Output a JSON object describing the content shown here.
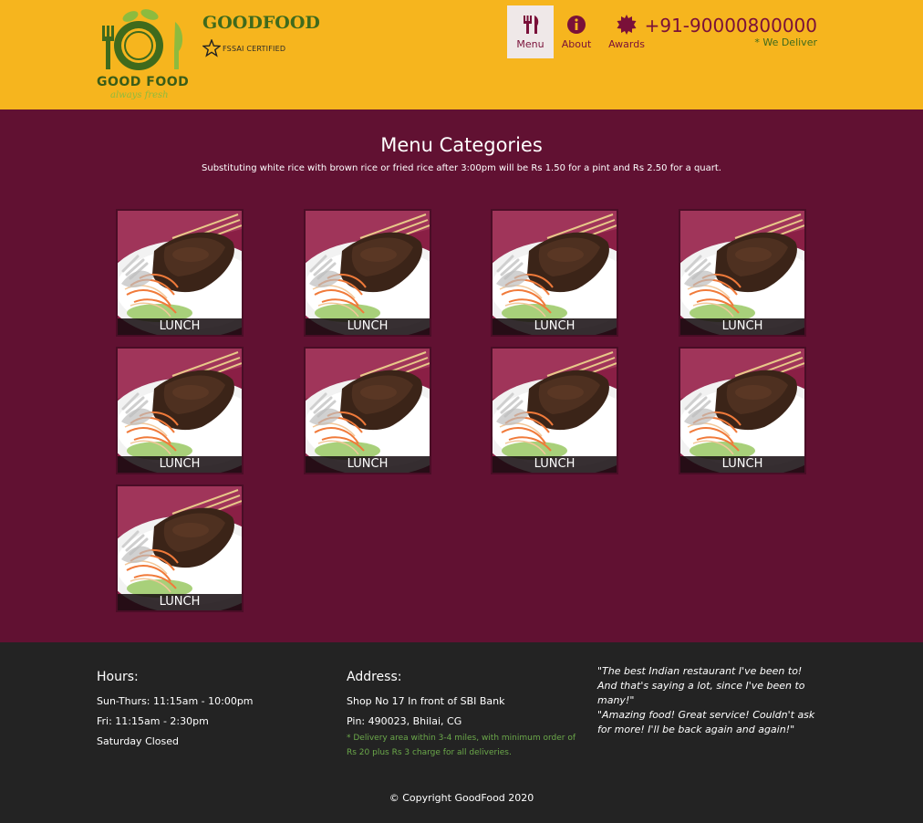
{
  "header": {
    "logo_text": "GOOD FOOD",
    "logo_tagline": "always fresh",
    "brand": "GOODFOOD",
    "certification": "FSSAI CERTIFIED",
    "phone": "+91-90000800000",
    "delivery_note": "* We Deliver"
  },
  "nav": {
    "items": [
      {
        "label": "Menu",
        "icon": "fork-knife-icon",
        "active": true
      },
      {
        "label": "About",
        "icon": "info-circle-icon",
        "active": false
      },
      {
        "label": "Awards",
        "icon": "award-badge-icon",
        "active": false
      }
    ]
  },
  "main": {
    "title": "Menu Categories",
    "subtitle": "Substituting white rice with brown rice or fried rice after 3:00pm will be Rs 1.50 for a pint and Rs 2.50 for a quart.",
    "categories": [
      {
        "label": "LUNCH"
      },
      {
        "label": "LUNCH"
      },
      {
        "label": "LUNCH"
      },
      {
        "label": "LUNCH"
      },
      {
        "label": "LUNCH"
      },
      {
        "label": "LUNCH"
      },
      {
        "label": "LUNCH"
      },
      {
        "label": "LUNCH"
      },
      {
        "label": "LUNCH"
      }
    ]
  },
  "footer": {
    "hours": {
      "heading": "Hours:",
      "lines": [
        "Sun-Thurs: 11:15am - 10:00pm",
        "Fri: 11:15am - 2:30pm",
        "Saturday Closed"
      ]
    },
    "address": {
      "heading": "Address:",
      "lines": [
        "Shop No 17 In front of SBI Bank",
        "Pin: 490023, Bhilai, CG"
      ],
      "note": "* Delivery area within 3-4 miles, with minimum order of Rs 20 plus Rs 3 charge for all deliveries."
    },
    "quotes": [
      "\"The best Indian restaurant I've been to! And that's saying a lot, since I've been to many!\"",
      "\"Amazing food! Great service! Couldn't ask for more! I'll be back again and again!\""
    ],
    "copyright": "© Copyright GoodFood 2020"
  },
  "colors": {
    "header_bg": "#f6b51e",
    "main_bg": "#611132",
    "footer_bg": "#232323",
    "accent": "#7a1039",
    "green": "#3f6a1c"
  }
}
